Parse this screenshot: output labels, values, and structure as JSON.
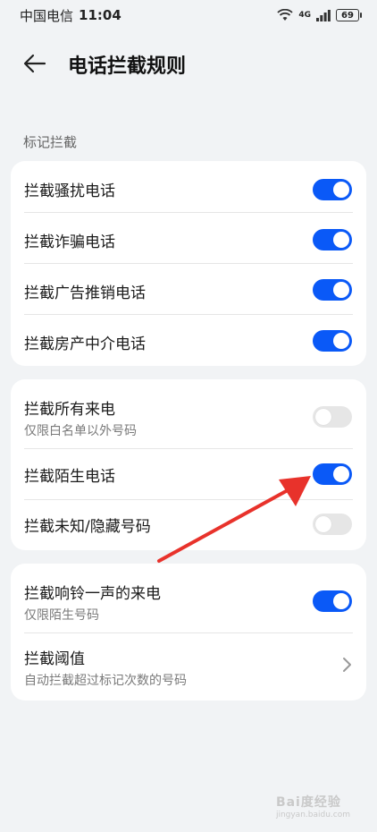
{
  "status_bar": {
    "carrier": "中国电信",
    "time": "11:04",
    "network": "4G",
    "battery": "69"
  },
  "header": {
    "back_icon": "arrow-left-icon",
    "title": "电话拦截规则"
  },
  "section_label": "标记拦截",
  "card1": {
    "items": [
      {
        "label": "拦截骚扰电话",
        "on": true
      },
      {
        "label": "拦截诈骗电话",
        "on": true
      },
      {
        "label": "拦截广告推销电话",
        "on": true
      },
      {
        "label": "拦截房产中介电话",
        "on": true
      }
    ]
  },
  "card2": {
    "items": [
      {
        "label": "拦截所有来电",
        "sub": "仅限白名单以外号码",
        "on": false
      },
      {
        "label": "拦截陌生电话",
        "on": true
      },
      {
        "label": "拦截未知/隐藏号码",
        "on": false
      }
    ]
  },
  "card3": {
    "items": [
      {
        "label": "拦截响铃一声的来电",
        "sub": "仅限陌生号码",
        "on": true
      },
      {
        "label": "拦截阈值",
        "sub": "自动拦截超过标记次数的号码",
        "chevron_icon": "chevron-right-icon"
      }
    ]
  },
  "watermark": {
    "brand": "Bai度经验",
    "url": "jingyan.baidu.com"
  },
  "colors": {
    "accent": "#0a59f7",
    "annotation": "#e8322b",
    "background": "#f1f3f5"
  }
}
